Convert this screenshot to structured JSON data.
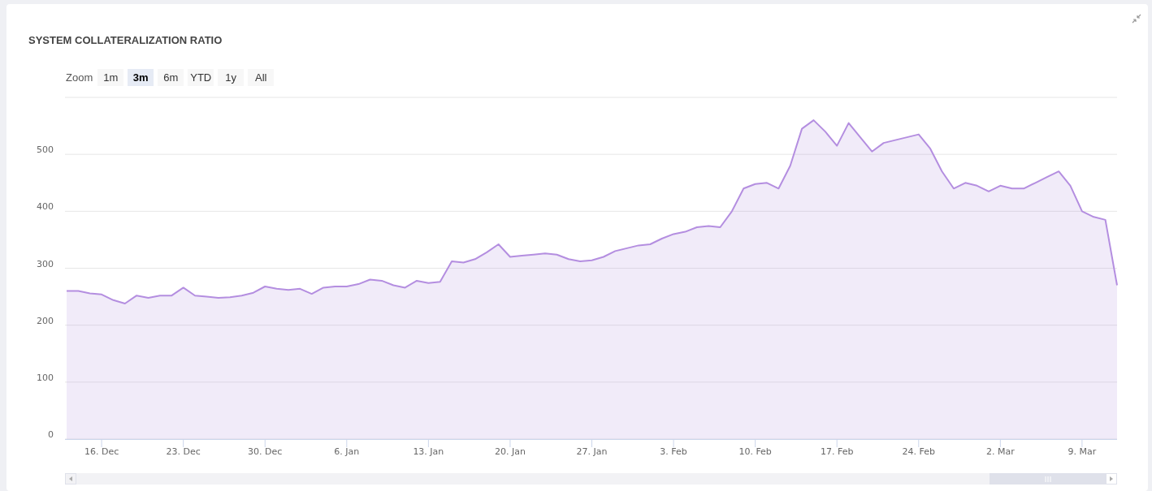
{
  "panel": {
    "title": "SYSTEM COLLATERALIZATION RATIO",
    "zoom": {
      "label": "Zoom",
      "buttons": [
        {
          "label": "1m",
          "selected": false
        },
        {
          "label": "3m",
          "selected": true
        },
        {
          "label": "6m",
          "selected": false
        },
        {
          "label": "YTD",
          "selected": false
        },
        {
          "label": "1y",
          "selected": false
        },
        {
          "label": "All",
          "selected": false
        }
      ]
    },
    "chart_data": {
      "type": "area",
      "categories": [
        null,
        null,
        null,
        "16. Dec",
        null,
        null,
        null,
        null,
        null,
        null,
        "23. Dec",
        null,
        null,
        null,
        null,
        null,
        null,
        "30. Dec",
        null,
        null,
        null,
        null,
        null,
        null,
        "6. Jan",
        null,
        null,
        null,
        null,
        null,
        null,
        "13. Jan",
        null,
        null,
        null,
        null,
        null,
        null,
        "20. Jan",
        null,
        null,
        null,
        null,
        null,
        null,
        "27. Jan",
        null,
        null,
        null,
        null,
        null,
        null,
        "3. Feb",
        null,
        null,
        null,
        null,
        null,
        null,
        "10. Feb",
        null,
        null,
        null,
        null,
        null,
        null,
        "17. Feb",
        null,
        null,
        null,
        null,
        null,
        null,
        "24. Feb",
        null,
        null,
        null,
        null,
        null,
        null,
        "2. Mar",
        null,
        null,
        null,
        null,
        null,
        null,
        "9. Mar",
        null,
        null,
        null
      ],
      "grid": true,
      "series": [
        {
          "color": "#b48ee0",
          "values": [
            260,
            260,
            256,
            254,
            244,
            238,
            252,
            248,
            252,
            252,
            266,
            252,
            250,
            248,
            249,
            252,
            257,
            268,
            264,
            262,
            264,
            255,
            266,
            268,
            268,
            272,
            280,
            278,
            270,
            266,
            278,
            274,
            276,
            312,
            310,
            316,
            328,
            342,
            320,
            322,
            324,
            326,
            324,
            316,
            312,
            314,
            320,
            330,
            335,
            340,
            342,
            352,
            360,
            364,
            372,
            374,
            372,
            400,
            440,
            448,
            450,
            440,
            480,
            545,
            560,
            540,
            515,
            555,
            530,
            505,
            520,
            525,
            530,
            535,
            510,
            470,
            440,
            450,
            445,
            435,
            445,
            440,
            440,
            450,
            460,
            470,
            445,
            400,
            390,
            385,
            270
          ]
        }
      ],
      "ylim": [
        0,
        600
      ],
      "yticks": [
        0,
        100,
        200,
        300,
        400,
        500
      ]
    }
  }
}
